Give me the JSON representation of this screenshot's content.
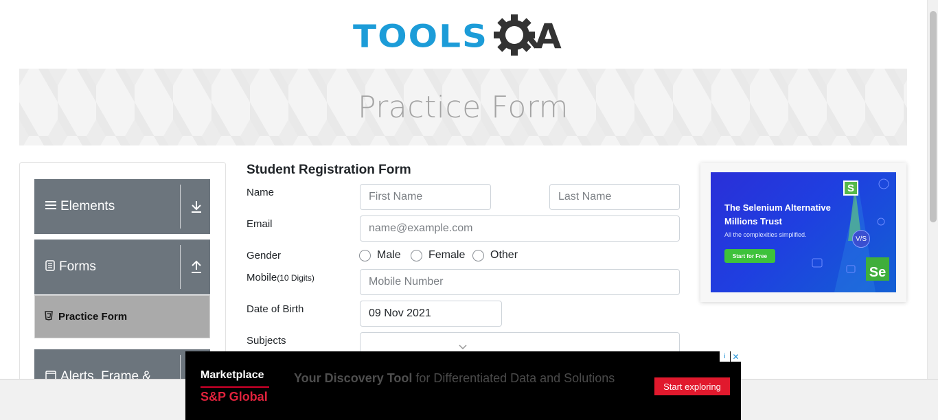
{
  "logo": {
    "text": "TOOLS",
    "suffix": "A"
  },
  "banner": {
    "title": "Practice Form"
  },
  "sidebar": {
    "groups": [
      {
        "label": "Elements",
        "icon": "hamburger-icon",
        "arrow": "download-arrow-icon"
      },
      {
        "label": "Forms",
        "icon": "document-icon",
        "arrow": "upload-arrow-icon"
      },
      {
        "label": "Alerts, Frame &",
        "icon": "window-icon",
        "arrow": "download-arrow-icon"
      }
    ],
    "active_item": {
      "label": "Practice Form",
      "icon": "html5-icon"
    }
  },
  "form": {
    "title": "Student Registration Form",
    "name_label": "Name",
    "first_name_placeholder": "First Name",
    "last_name_placeholder": "Last Name",
    "email_label": "Email",
    "email_placeholder": "name@example.com",
    "gender_label": "Gender",
    "gender_options": [
      "Male",
      "Female",
      "Other"
    ],
    "mobile_label": "Mobile",
    "mobile_hint": "(10 Digits)",
    "mobile_placeholder": "Mobile Number",
    "dob_label": "Date of Birth",
    "dob_value": "09 Nov 2021",
    "subjects_label": "Subjects"
  },
  "side_ad": {
    "headline": "The Selenium Alternative Millions Trust",
    "subtext": "All the complexities simplified.",
    "button": "Start for Free",
    "badge_s": "S",
    "badge_se": "Se",
    "badge_vs": "V/S"
  },
  "bottom_ad": {
    "brand_line1": "Marketplace",
    "brand_line2": "S&P Global",
    "tagline_bold": "Your Discovery Tool",
    "tagline_rest": " for Differentiated Data and Solutions",
    "cta": "Start exploring",
    "info": "i",
    "close": "✕"
  },
  "colors": {
    "logo_blue": "#1c9cd8",
    "sidebar_group": "#6c757d",
    "active_item": "#aaaaaa",
    "ad_cta": "#e1192d"
  }
}
